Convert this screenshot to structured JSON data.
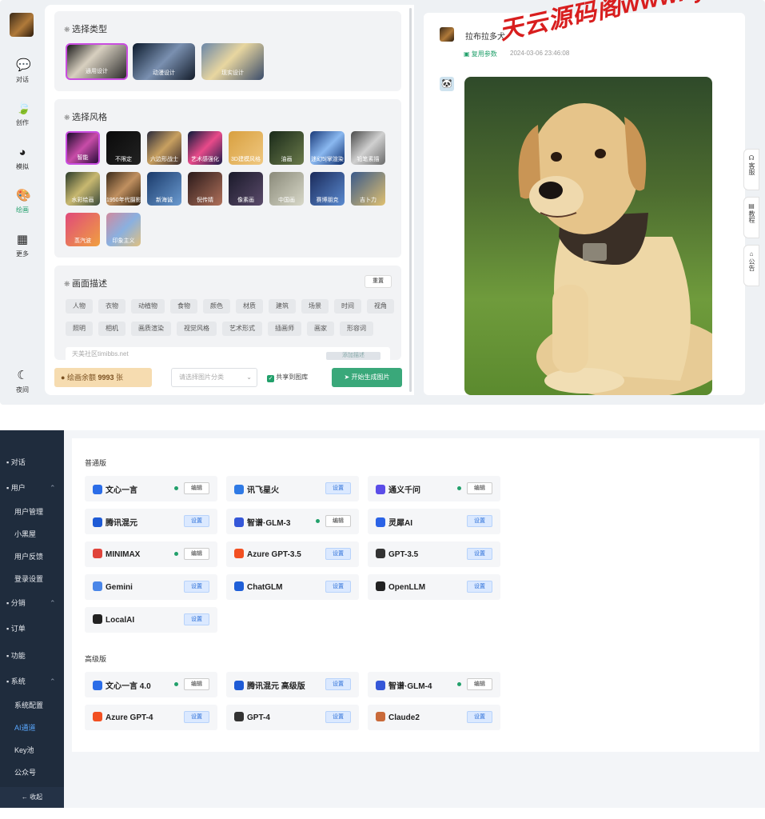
{
  "nav": {
    "items": [
      {
        "label": "对话",
        "icon": "chat-bubble-icon"
      },
      {
        "label": "创作",
        "icon": "leaf-icon"
      },
      {
        "label": "模拟",
        "icon": "planet-icon"
      },
      {
        "label": "绘画",
        "icon": "palette-icon"
      },
      {
        "label": "更多",
        "icon": "grid-icon"
      }
    ],
    "night": {
      "label": "夜间",
      "icon": "moon-icon"
    }
  },
  "type_section": {
    "title": "选择类型",
    "items": [
      "通用设计",
      "动漫设计",
      "现实设计"
    ]
  },
  "style_section": {
    "title": "选择风格",
    "items": [
      "智能",
      "不限定",
      "六边形战士",
      "艺术感强化",
      "3D建模风格",
      "油画",
      "迷幻5|掌渲染",
      "铅笔素描",
      "水彩绘画",
      "1950年代摄影",
      "新海诚",
      "倪传婧",
      "像素画",
      "中国画",
      "赛博朋克",
      "吉卜力",
      "蒸汽波",
      "印象主义"
    ]
  },
  "desc_section": {
    "title": "画面描述",
    "reset": "重置",
    "tags_row1": [
      "人物",
      "衣物",
      "动植物",
      "食物",
      "颜色",
      "材质",
      "建筑",
      "场景",
      "时间",
      "视角"
    ],
    "tags_row2": [
      "照明",
      "相机",
      "画质渲染",
      "视觉风格",
      "艺术形式",
      "插画师",
      "画家",
      "形容词"
    ],
    "placeholder": "天美社区timibbs.net",
    "insert_btn": "添加描述"
  },
  "footer": {
    "balance_label": "绘画余额",
    "balance": "9993",
    "balance_unit": "张",
    "category_placeholder": "请选择图片分类",
    "share_label": "共享到图库",
    "generate_btn": "开始生成图片"
  },
  "chat": {
    "title": "拉布拉多犬",
    "reuse": "复用参数",
    "time": "2024-03-06 23:46:08"
  },
  "side_tabs": [
    "客服",
    "教程",
    "公告"
  ],
  "watermark": "天云源码阁www.tyzyj.cn",
  "admin": {
    "sidebar": [
      {
        "label": "对话",
        "type": "top"
      },
      {
        "label": "用户",
        "type": "group"
      },
      {
        "label": "用户管理",
        "type": "sub"
      },
      {
        "label": "小黑屋",
        "type": "sub"
      },
      {
        "label": "用户反馈",
        "type": "sub"
      },
      {
        "label": "登录设置",
        "type": "sub"
      },
      {
        "label": "分销",
        "type": "group"
      },
      {
        "label": "订单",
        "type": "top"
      },
      {
        "label": "功能",
        "type": "top"
      },
      {
        "label": "系统",
        "type": "group"
      },
      {
        "label": "系统配置",
        "type": "sub"
      },
      {
        "label": "AI通道",
        "type": "sub-active"
      },
      {
        "label": "Key池",
        "type": "sub"
      },
      {
        "label": "公众号",
        "type": "sub"
      }
    ],
    "collapse": "收起",
    "normal_title": "普通版",
    "normal": [
      {
        "name": "文心一言",
        "action": "编辑",
        "on": true,
        "color": "#2b6de8"
      },
      {
        "name": "讯飞星火",
        "action": "设置",
        "on": false,
        "color": "#2f7ae5"
      },
      {
        "name": "通义千问",
        "action": "编辑",
        "on": true,
        "color": "#5b4de8"
      },
      {
        "name": "腾讯混元",
        "action": "设置",
        "on": false,
        "color": "#1e5bd6"
      },
      {
        "name": "智谱·GLM-3",
        "action": "编辑",
        "on": true,
        "color": "#3557d8"
      },
      {
        "name": "灵犀AI",
        "action": "设置",
        "on": false,
        "color": "#2b63e6"
      },
      {
        "name": "MINIMAX",
        "action": "编辑",
        "on": true,
        "color": "#e0443b"
      },
      {
        "name": "Azure GPT-3.5",
        "action": "设置",
        "on": false,
        "color": "#f25022"
      },
      {
        "name": "GPT-3.5",
        "action": "设置",
        "on": false,
        "color": "#333333"
      },
      {
        "name": "Gemini",
        "action": "设置",
        "on": false,
        "color": "#4a86e8"
      },
      {
        "name": "ChatGLM",
        "action": "设置",
        "on": false,
        "color": "#1f5fd8"
      },
      {
        "name": "OpenLLM",
        "action": "设置",
        "on": false,
        "color": "#222222"
      },
      {
        "name": "LocalAI",
        "action": "设置",
        "on": false,
        "color": "#222222"
      }
    ],
    "adv_title": "高级版",
    "advanced": [
      {
        "name": "文心一言 4.0",
        "action": "编辑",
        "on": true,
        "color": "#2b6de8"
      },
      {
        "name": "腾讯混元 高级版",
        "action": "设置",
        "on": false,
        "color": "#1e5bd6"
      },
      {
        "name": "智谱·GLM-4",
        "action": "编辑",
        "on": true,
        "color": "#3557d8"
      },
      {
        "name": "Azure GPT-4",
        "action": "设置",
        "on": false,
        "color": "#f25022"
      },
      {
        "name": "GPT-4",
        "action": "设置",
        "on": false,
        "color": "#333333"
      },
      {
        "name": "Claude2",
        "action": "设置",
        "on": false,
        "color": "#c96a3a"
      }
    ]
  }
}
